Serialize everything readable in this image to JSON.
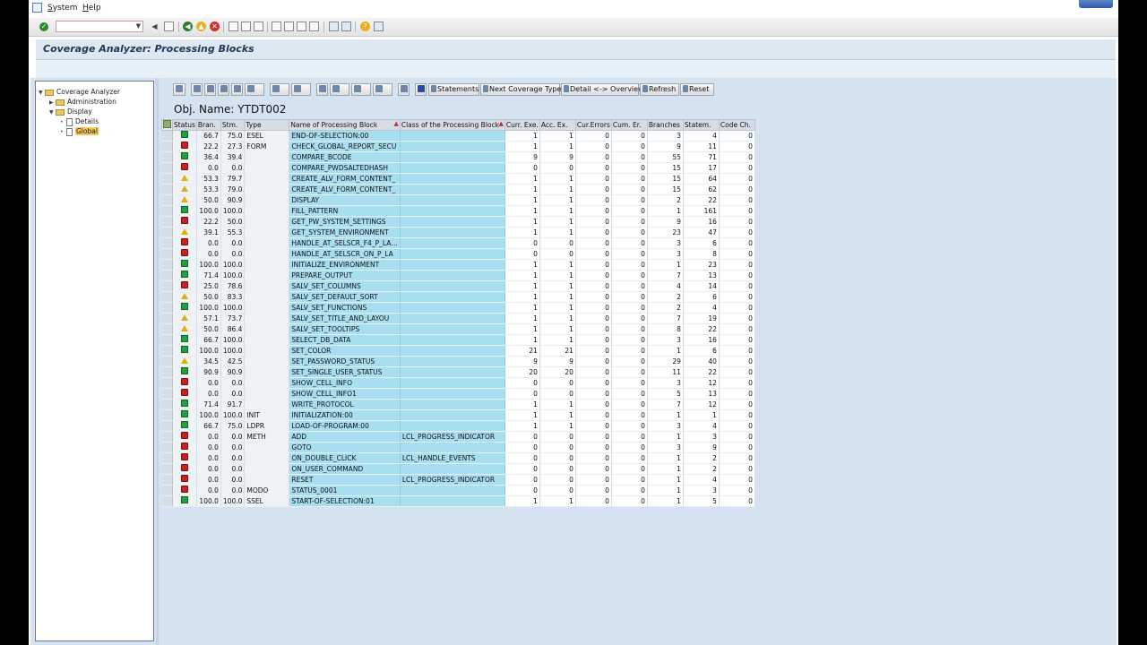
{
  "menu": {
    "system": "System",
    "help": "Help"
  },
  "title": "Coverage Analyzer: Processing Blocks",
  "tree": [
    {
      "label": "Coverage Analyzer",
      "level": 0,
      "type": "folder",
      "open": true
    },
    {
      "label": "Administration",
      "level": 1,
      "type": "folder",
      "open": false
    },
    {
      "label": "Display",
      "level": 1,
      "type": "folder",
      "open": true
    },
    {
      "label": "Details",
      "level": 2,
      "type": "doc"
    },
    {
      "label": "Global",
      "level": 2,
      "type": "doc",
      "selected": true
    }
  ],
  "alv_toolbar": {
    "statements": "Statements",
    "next_coverage": "Next Coverage Type",
    "detail_overview": "Detail <-> Overview",
    "refresh": "Refresh",
    "reset": "Reset"
  },
  "obj_name": "Obj. Name: YTDT002",
  "columns": [
    "Status",
    "Bran.",
    "Stm.",
    "Type",
    "Name of Processing Block",
    "Class of the Processing Block",
    "Curr. Exe.",
    "Acc. Ex.",
    "Cur.Errors",
    "Cum. Er.",
    "Branches",
    "Statem.",
    "Code Ch."
  ],
  "rows": [
    {
      "status": "green",
      "bran": "66.7",
      "stm": "75.0",
      "type": "ESEL",
      "name": "END-OF-SELECTION:00",
      "class": "",
      "curr": "1",
      "acc": "1",
      "cerr": "0",
      "cumerr": "0",
      "branches": "3",
      "statem": "4",
      "codech": "0"
    },
    {
      "status": "red",
      "bran": "22.2",
      "stm": "27.3",
      "type": "FORM",
      "name": "CHECK_GLOBAL_REPORT_SECU",
      "class": "",
      "curr": "1",
      "acc": "1",
      "cerr": "0",
      "cumerr": "0",
      "branches": "9",
      "statem": "11",
      "codech": "0"
    },
    {
      "status": "green",
      "bran": "36.4",
      "stm": "39.4",
      "type": "",
      "name": "COMPARE_BCODE",
      "class": "",
      "curr": "9",
      "acc": "9",
      "cerr": "0",
      "cumerr": "0",
      "branches": "55",
      "statem": "71",
      "codech": "0"
    },
    {
      "status": "red",
      "bran": "0.0",
      "stm": "0.0",
      "type": "",
      "name": "COMPARE_PWDSALTEDHASH",
      "class": "",
      "curr": "0",
      "acc": "0",
      "cerr": "0",
      "cumerr": "0",
      "branches": "15",
      "statem": "17",
      "codech": "0"
    },
    {
      "status": "yellow",
      "bran": "53.3",
      "stm": "79.7",
      "type": "",
      "name": "CREATE_ALV_FORM_CONTENT_",
      "class": "",
      "curr": "1",
      "acc": "1",
      "cerr": "0",
      "cumerr": "0",
      "branches": "15",
      "statem": "64",
      "codech": "0"
    },
    {
      "status": "yellow",
      "bran": "53.3",
      "stm": "79.0",
      "type": "",
      "name": "CREATE_ALV_FORM_CONTENT_",
      "class": "",
      "curr": "1",
      "acc": "1",
      "cerr": "0",
      "cumerr": "0",
      "branches": "15",
      "statem": "62",
      "codech": "0"
    },
    {
      "status": "yellow",
      "bran": "50.0",
      "stm": "90.9",
      "type": "",
      "name": "DISPLAY",
      "class": "",
      "curr": "1",
      "acc": "1",
      "cerr": "0",
      "cumerr": "0",
      "branches": "2",
      "statem": "22",
      "codech": "0"
    },
    {
      "status": "green",
      "bran": "100.0",
      "stm": "100.0",
      "type": "",
      "name": "FILL_PATTERN",
      "class": "",
      "curr": "1",
      "acc": "1",
      "cerr": "0",
      "cumerr": "0",
      "branches": "1",
      "statem": "161",
      "codech": "0"
    },
    {
      "status": "red",
      "bran": "22.2",
      "stm": "50.0",
      "type": "",
      "name": "GET_PW_SYSTEM_SETTINGS",
      "class": "",
      "curr": "1",
      "acc": "1",
      "cerr": "0",
      "cumerr": "0",
      "branches": "9",
      "statem": "16",
      "codech": "0"
    },
    {
      "status": "yellow",
      "bran": "39.1",
      "stm": "55.3",
      "type": "",
      "name": "GET_SYSTEM_ENVIRONMENT",
      "class": "",
      "curr": "1",
      "acc": "1",
      "cerr": "0",
      "cumerr": "0",
      "branches": "23",
      "statem": "47",
      "codech": "0"
    },
    {
      "status": "red",
      "bran": "0.0",
      "stm": "0.0",
      "type": "",
      "name": "HANDLE_AT_SELSCR_F4_P_LA…",
      "class": "",
      "curr": "0",
      "acc": "0",
      "cerr": "0",
      "cumerr": "0",
      "branches": "3",
      "statem": "6",
      "codech": "0"
    },
    {
      "status": "red",
      "bran": "0.0",
      "stm": "0.0",
      "type": "",
      "name": "HANDLE_AT_SELSCR_ON_P_LA",
      "class": "",
      "curr": "0",
      "acc": "0",
      "cerr": "0",
      "cumerr": "0",
      "branches": "3",
      "statem": "8",
      "codech": "0"
    },
    {
      "status": "green",
      "bran": "100.0",
      "stm": "100.0",
      "type": "",
      "name": "INITIALIZE_ENVIRONMENT",
      "class": "",
      "curr": "1",
      "acc": "1",
      "cerr": "0",
      "cumerr": "0",
      "branches": "1",
      "statem": "23",
      "codech": "0"
    },
    {
      "status": "green",
      "bran": "71.4",
      "stm": "100.0",
      "type": "",
      "name": "PREPARE_OUTPUT",
      "class": "",
      "curr": "1",
      "acc": "1",
      "cerr": "0",
      "cumerr": "0",
      "branches": "7",
      "statem": "13",
      "codech": "0"
    },
    {
      "status": "red",
      "bran": "25.0",
      "stm": "78.6",
      "type": "",
      "name": "SALV_SET_COLUMNS",
      "class": "",
      "curr": "1",
      "acc": "1",
      "cerr": "0",
      "cumerr": "0",
      "branches": "4",
      "statem": "14",
      "codech": "0"
    },
    {
      "status": "yellow",
      "bran": "50.0",
      "stm": "83.3",
      "type": "",
      "name": "SALV_SET_DEFAULT_SORT",
      "class": "",
      "curr": "1",
      "acc": "1",
      "cerr": "0",
      "cumerr": "0",
      "branches": "2",
      "statem": "6",
      "codech": "0"
    },
    {
      "status": "green",
      "bran": "100.0",
      "stm": "100.0",
      "type": "",
      "name": "SALV_SET_FUNCTIONS",
      "class": "",
      "curr": "1",
      "acc": "1",
      "cerr": "0",
      "cumerr": "0",
      "branches": "2",
      "statem": "4",
      "codech": "0"
    },
    {
      "status": "yellow",
      "bran": "57.1",
      "stm": "73.7",
      "type": "",
      "name": "SALV_SET_TITLE_AND_LAYOU",
      "class": "",
      "curr": "1",
      "acc": "1",
      "cerr": "0",
      "cumerr": "0",
      "branches": "7",
      "statem": "19",
      "codech": "0"
    },
    {
      "status": "yellow",
      "bran": "50.0",
      "stm": "86.4",
      "type": "",
      "name": "SALV_SET_TOOLTIPS",
      "class": "",
      "curr": "1",
      "acc": "1",
      "cerr": "0",
      "cumerr": "0",
      "branches": "8",
      "statem": "22",
      "codech": "0"
    },
    {
      "status": "green",
      "bran": "66.7",
      "stm": "100.0",
      "type": "",
      "name": "SELECT_DB_DATA",
      "class": "",
      "curr": "1",
      "acc": "1",
      "cerr": "0",
      "cumerr": "0",
      "branches": "3",
      "statem": "16",
      "codech": "0"
    },
    {
      "status": "green",
      "bran": "100.0",
      "stm": "100.0",
      "type": "",
      "name": "SET_COLOR",
      "class": "",
      "curr": "21",
      "acc": "21",
      "cerr": "0",
      "cumerr": "0",
      "branches": "1",
      "statem": "6",
      "codech": "0"
    },
    {
      "status": "yellow",
      "bran": "34.5",
      "stm": "42.5",
      "type": "",
      "name": "SET_PASSWORD_STATUS",
      "class": "",
      "curr": "9",
      "acc": "9",
      "cerr": "0",
      "cumerr": "0",
      "branches": "29",
      "statem": "40",
      "codech": "0"
    },
    {
      "status": "green",
      "bran": "90.9",
      "stm": "90.9",
      "type": "",
      "name": "SET_SINGLE_USER_STATUS",
      "class": "",
      "curr": "20",
      "acc": "20",
      "cerr": "0",
      "cumerr": "0",
      "branches": "11",
      "statem": "22",
      "codech": "0"
    },
    {
      "status": "red",
      "bran": "0.0",
      "stm": "0.0",
      "type": "",
      "name": "SHOW_CELL_INFO",
      "class": "",
      "curr": "0",
      "acc": "0",
      "cerr": "0",
      "cumerr": "0",
      "branches": "3",
      "statem": "12",
      "codech": "0"
    },
    {
      "status": "red",
      "bran": "0.0",
      "stm": "0.0",
      "type": "",
      "name": "SHOW_CELL_INFO1",
      "class": "",
      "curr": "0",
      "acc": "0",
      "cerr": "0",
      "cumerr": "0",
      "branches": "5",
      "statem": "13",
      "codech": "0"
    },
    {
      "status": "green",
      "bran": "71.4",
      "stm": "91.7",
      "type": "",
      "name": "WRITE_PROTOCOL",
      "class": "",
      "curr": "1",
      "acc": "1",
      "cerr": "0",
      "cumerr": "0",
      "branches": "7",
      "statem": "12",
      "codech": "0"
    },
    {
      "status": "green",
      "bran": "100.0",
      "stm": "100.0",
      "type": "INIT",
      "name": "INITIALIZATION:00",
      "class": "",
      "curr": "1",
      "acc": "1",
      "cerr": "0",
      "cumerr": "0",
      "branches": "1",
      "statem": "1",
      "codech": "0"
    },
    {
      "status": "green",
      "bran": "66.7",
      "stm": "75.0",
      "type": "LDPR",
      "name": "LOAD-OF-PROGRAM:00",
      "class": "",
      "curr": "1",
      "acc": "1",
      "cerr": "0",
      "cumerr": "0",
      "branches": "3",
      "statem": "4",
      "codech": "0"
    },
    {
      "status": "red",
      "bran": "0.0",
      "stm": "0.0",
      "type": "METH",
      "name": "ADD",
      "class": "LCL_PROGRESS_INDICATOR",
      "curr": "0",
      "acc": "0",
      "cerr": "0",
      "cumerr": "0",
      "branches": "1",
      "statem": "3",
      "codech": "0"
    },
    {
      "status": "red",
      "bran": "0.0",
      "stm": "0.0",
      "type": "",
      "name": "GOTO",
      "class": "",
      "curr": "0",
      "acc": "0",
      "cerr": "0",
      "cumerr": "0",
      "branches": "3",
      "statem": "9",
      "codech": "0"
    },
    {
      "status": "red",
      "bran": "0.0",
      "stm": "0.0",
      "type": "",
      "name": "ON_DOUBLE_CLICK",
      "class": "LCL_HANDLE_EVENTS",
      "curr": "0",
      "acc": "0",
      "cerr": "0",
      "cumerr": "0",
      "branches": "1",
      "statem": "2",
      "codech": "0"
    },
    {
      "status": "red",
      "bran": "0.0",
      "stm": "0.0",
      "type": "",
      "name": "ON_USER_COMMAND",
      "class": "",
      "curr": "0",
      "acc": "0",
      "cerr": "0",
      "cumerr": "0",
      "branches": "1",
      "statem": "2",
      "codech": "0"
    },
    {
      "status": "red",
      "bran": "0.0",
      "stm": "0.0",
      "type": "",
      "name": "RESET",
      "class": "LCL_PROGRESS_INDICATOR",
      "curr": "0",
      "acc": "0",
      "cerr": "0",
      "cumerr": "0",
      "branches": "1",
      "statem": "4",
      "codech": "0"
    },
    {
      "status": "red",
      "bran": "0.0",
      "stm": "0.0",
      "type": "MODO",
      "name": "STATUS_0001",
      "class": "",
      "curr": "0",
      "acc": "0",
      "cerr": "0",
      "cumerr": "0",
      "branches": "1",
      "statem": "3",
      "codech": "0"
    },
    {
      "status": "green",
      "bran": "100.0",
      "stm": "100.0",
      "type": "SSEL",
      "name": "START-OF-SELECTION:01",
      "class": "",
      "curr": "1",
      "acc": "1",
      "cerr": "0",
      "cumerr": "0",
      "branches": "1",
      "statem": "5",
      "codech": "0"
    }
  ],
  "colors": {
    "status_green": "#1fa03a",
    "status_red": "#cc2020",
    "status_yellow": "#e0b010",
    "key_column_bg": "#a8dff0",
    "title_text": "#203a58"
  }
}
